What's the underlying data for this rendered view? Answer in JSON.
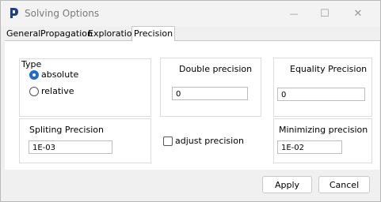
{
  "window": {
    "title": "Solving Options",
    "minimize_glyph": "—",
    "maximize_glyph": "☐",
    "close_glyph": "✕"
  },
  "tabs": [
    {
      "label": "General"
    },
    {
      "label": "Propagation"
    },
    {
      "label": "Exploration"
    },
    {
      "label": "Precision"
    }
  ],
  "precision": {
    "type_label": "Type",
    "radio_absolute": "absolute",
    "radio_relative": "relative",
    "selected": "absolute",
    "double_precision_label": "Double precision",
    "double_precision_value": "0",
    "equality_precision_label": "Equality  Precision",
    "equality_precision_value": "0",
    "spliting_precision_label": "Spliting Precision",
    "spliting_precision_value": "1E-03",
    "adjust_precision_label": "adjust precision",
    "adjust_precision_checked": false,
    "minimizing_precision_label": "Minimizing precision",
    "minimizing_precision_value": "1E-02"
  },
  "footer": {
    "apply_label": "Apply",
    "cancel_label": "Cancel"
  },
  "colors": {
    "accent": "#1e6bd6",
    "icon_blue": "#1a3f8f"
  }
}
